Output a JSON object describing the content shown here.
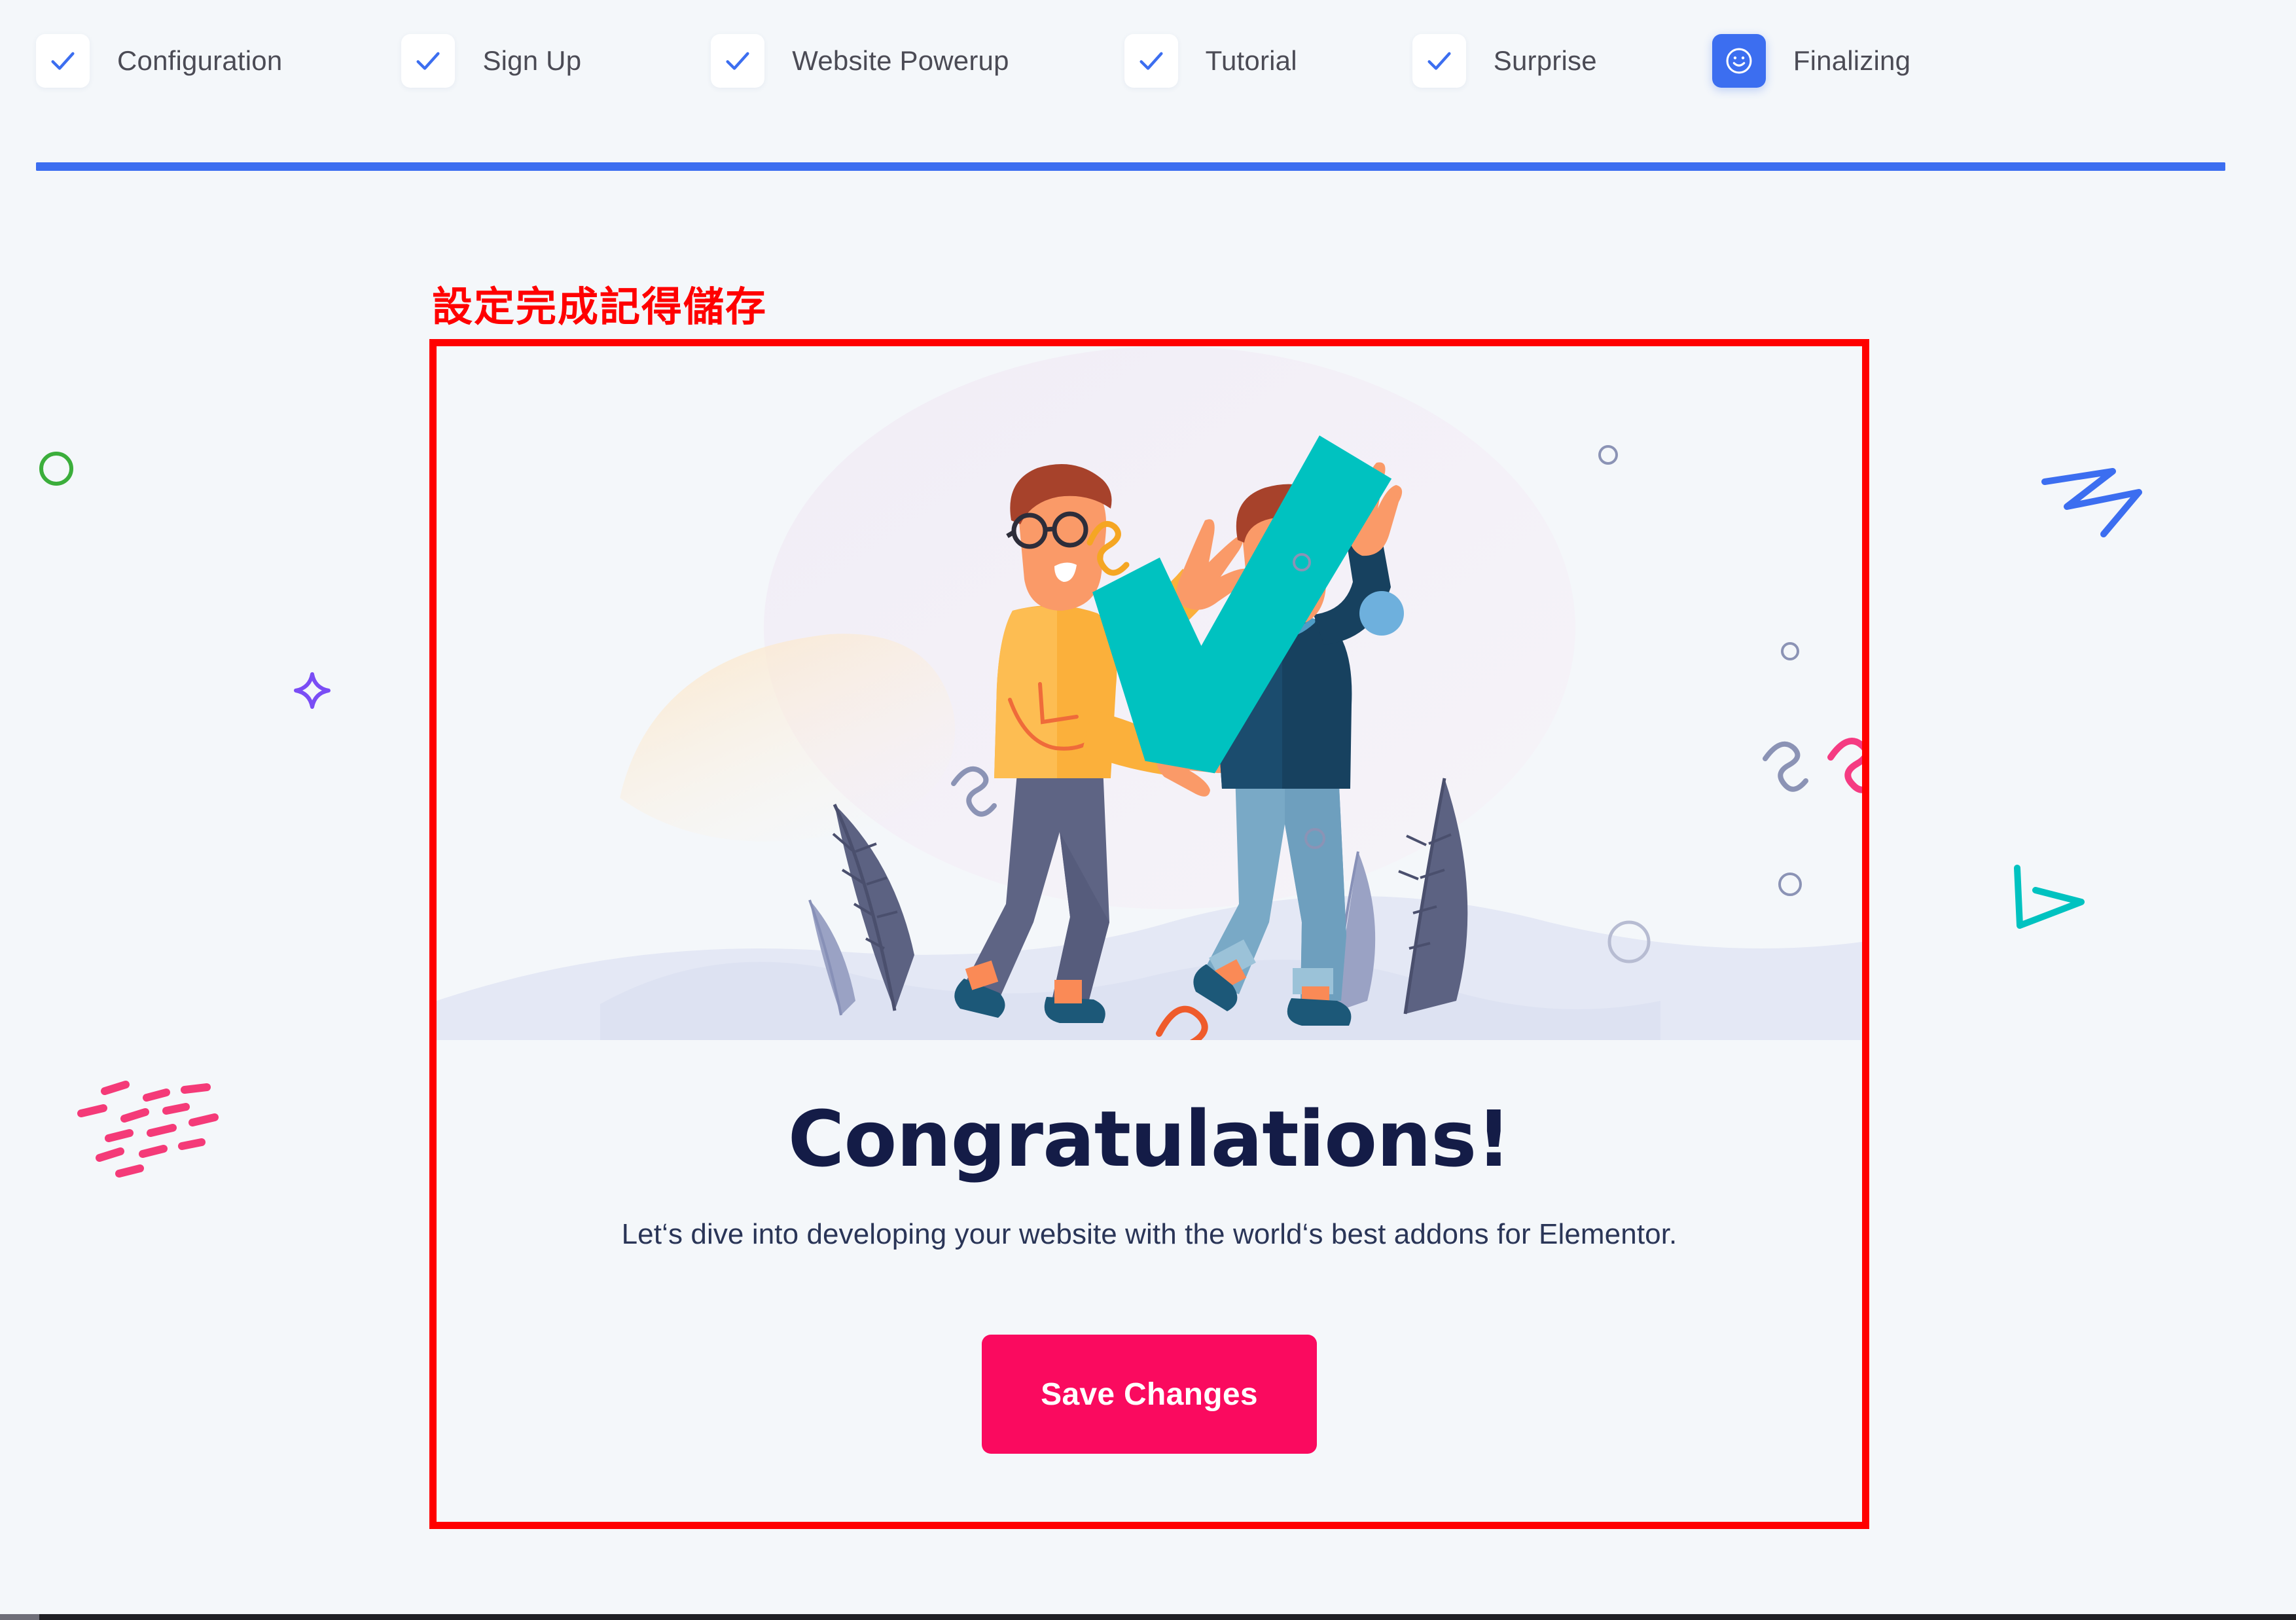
{
  "wizard": {
    "steps": [
      {
        "label": "Configuration",
        "state": "complete",
        "icon": "check-icon"
      },
      {
        "label": "Sign Up",
        "state": "complete",
        "icon": "check-icon"
      },
      {
        "label": "Website Powerup",
        "state": "complete",
        "icon": "check-icon"
      },
      {
        "label": "Tutorial",
        "state": "complete",
        "icon": "check-icon"
      },
      {
        "label": "Surprise",
        "state": "complete",
        "icon": "check-icon"
      },
      {
        "label": "Finalizing",
        "state": "current",
        "icon": "smiley-face-icon"
      }
    ],
    "progress_percent": 100,
    "progress_color": "#3C6EF0",
    "check_color": "#3C6EF0",
    "current_step_bg": "#3C6EF0"
  },
  "annotation": {
    "text": "設定完成記得儲存",
    "color": "#FF0000",
    "highlight_box_color": "#FF0000"
  },
  "card": {
    "illustration_name": "two-people-holding-giant-checkmark",
    "heading": "Congratulations!",
    "heading_color": "#141C47",
    "subheading": "Let‘s dive into developing your website with the world‘s best addons for Elementor.",
    "save_button_label": "Save Changes",
    "save_button_color": "#FA0A5F",
    "checkmark_color": "#00C2C0"
  },
  "decorations": [
    {
      "name": "green-circle-outline",
      "color": "#3BAE3B"
    },
    {
      "name": "purple-sparkle-star",
      "color": "#7A4DF5"
    },
    {
      "name": "pink-dash-cluster",
      "color": "#F43A78"
    },
    {
      "name": "blue-zigzag-scribble",
      "color": "#3C6EF0"
    },
    {
      "name": "teal-triangle-arrow",
      "color": "#00C2C0"
    }
  ],
  "page_background": "#F4F7FA"
}
